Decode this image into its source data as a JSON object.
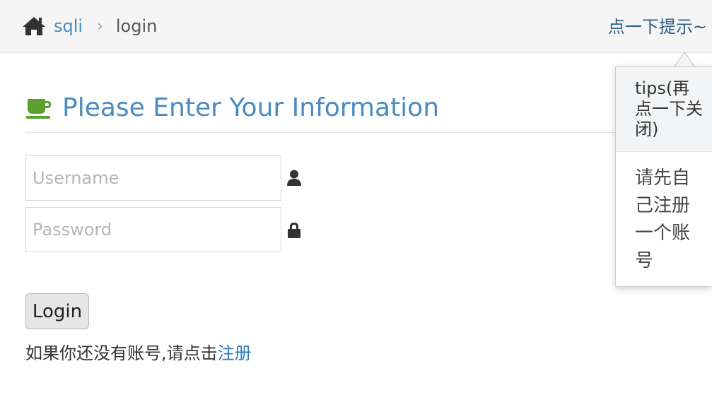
{
  "breadcrumb": {
    "home_icon": "home-icon",
    "root_label": "sqli",
    "separator": "›",
    "current_label": "login"
  },
  "hint_link_label": "点一下提示~",
  "heading": {
    "icon": "coffee-cup-icon",
    "text": "Please Enter Your Information",
    "icon_color": "#5aa02c",
    "text_color": "#4a8bc2"
  },
  "form": {
    "username_placeholder": "Username",
    "password_placeholder": "Password",
    "username_icon": "user-icon",
    "password_icon": "lock-icon",
    "login_label": "Login"
  },
  "register": {
    "prompt": "如果你还没有账号,请点击",
    "link_label": "注册"
  },
  "popover": {
    "title": "tips(再点一下关闭)",
    "body": "请先自己注册一个账号"
  }
}
